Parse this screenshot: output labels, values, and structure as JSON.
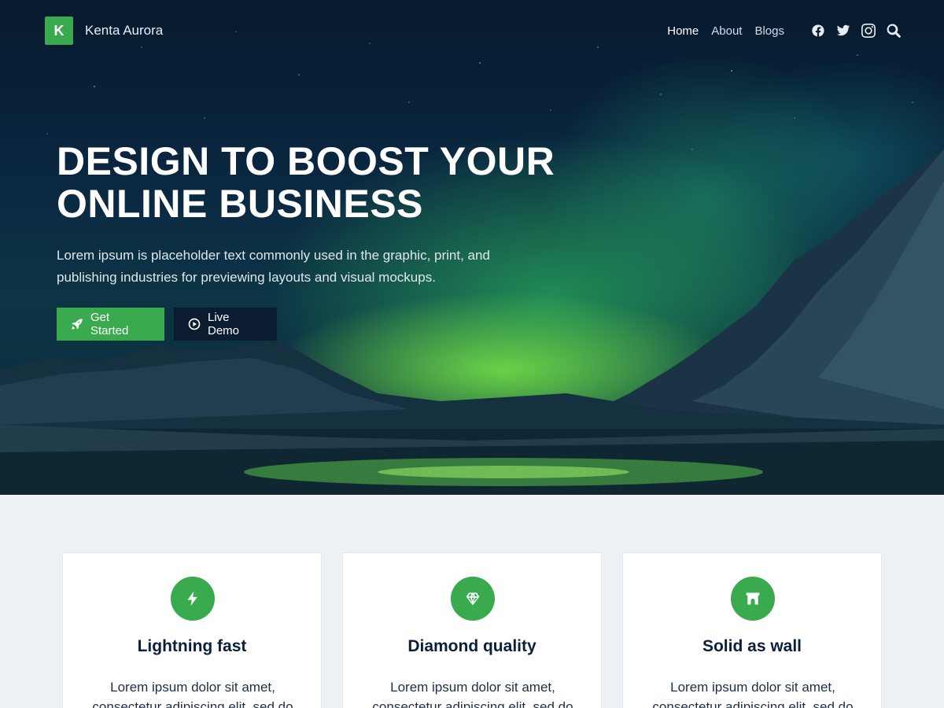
{
  "brand": {
    "logo_letter": "K",
    "name": "Kenta Aurora"
  },
  "nav": {
    "links": [
      "Home",
      "About",
      "Blogs"
    ],
    "active": "Home",
    "icons": [
      "facebook-icon",
      "twitter-icon",
      "instagram-icon",
      "search-icon"
    ]
  },
  "hero": {
    "title": "DESIGN TO BOOST YOUR\nONLINE BUSINESS",
    "subtitle": "Lorem ipsum is placeholder text commonly used in the graphic, print, and publishing industries for previewing layouts and visual mockups.",
    "primary_button": {
      "label": "Get Started",
      "icon": "rocket-icon"
    },
    "secondary_button": {
      "label": "Live Demo",
      "icon": "play-circle-icon"
    }
  },
  "features": [
    {
      "icon": "lightning-icon",
      "title": "Lightning fast",
      "text": "Lorem ipsum dolor sit amet, consectetur adipiscing elit, sed do"
    },
    {
      "icon": "diamond-icon",
      "title": "Diamond quality",
      "text": "Lorem ipsum dolor sit amet, consectetur adipiscing elit, sed do"
    },
    {
      "icon": "wall-icon",
      "title": "Solid as wall",
      "text": "Lorem ipsum dolor sit amet, consectetur adipiscing elit, sed do"
    }
  ],
  "colors": {
    "accent": "#3aaa4f",
    "dark_button": "#0b1b30",
    "heading": "#0b1f3a",
    "section_bg": "#eef2f6"
  }
}
